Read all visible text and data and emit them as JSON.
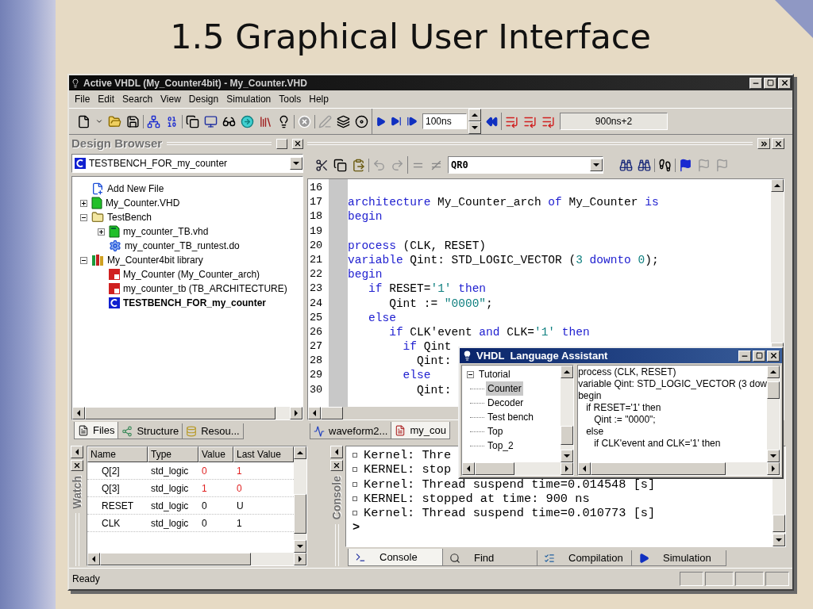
{
  "slide": {
    "title": "1.5 Graphical User Interface"
  },
  "window": {
    "title": "Active VHDL (My_Counter4bit) - My_Counter.VHD"
  },
  "menu": [
    "File",
    "Edit",
    "Search",
    "View",
    "Design",
    "Simulation",
    "Tools",
    "Help"
  ],
  "toolbar": {
    "time_step": "100ns",
    "sim_time": "900ns+2"
  },
  "design_browser": {
    "title": "Design Browser",
    "design": "TESTBENCH_FOR_my_counter",
    "tree": [
      {
        "label": "Add New File",
        "kind": "new_file"
      },
      {
        "label": "My_Counter.VHD",
        "kind": "source",
        "expanded": false
      },
      {
        "label": "TestBench",
        "kind": "folder",
        "expanded": true,
        "children": [
          {
            "label": "my_counter_TB.vhd",
            "kind": "testbench",
            "expanded": false
          },
          {
            "label": "my_counter_TB_runtest.do",
            "kind": "macro"
          }
        ]
      },
      {
        "label": "My_Counter4bit library",
        "kind": "library",
        "expanded": true,
        "children": [
          {
            "label": "My_Counter (My_Counter_arch)",
            "kind": "entity"
          },
          {
            "label": "my_counter_tb (TB_ARCHITECTURE)",
            "kind": "entity"
          },
          {
            "label": "TESTBENCH_FOR_my_counter",
            "kind": "config",
            "top_level": true
          }
        ]
      }
    ],
    "tabs": [
      {
        "label": "Files",
        "kind": "files",
        "selected": true
      },
      {
        "label": "Structure",
        "kind": "structure",
        "selected": false
      },
      {
        "label": "Resou...",
        "kind": "resources",
        "selected": false
      }
    ]
  },
  "editor": {
    "search": "QR0",
    "lines": [
      {
        "number": "16"
      },
      {
        "number": "17",
        "tokens": [
          {
            "text": "architecture",
            "kind": "keyword"
          },
          {
            "text": " My_Counter_arch ",
            "kind": "plain"
          },
          {
            "text": "of",
            "kind": "keyword"
          },
          {
            "text": " My_Counter ",
            "kind": "plain"
          },
          {
            "text": "is",
            "kind": "keyword"
          }
        ]
      },
      {
        "number": "18",
        "tokens": [
          {
            "text": "begin",
            "kind": "keyword"
          }
        ]
      },
      {
        "number": "19"
      },
      {
        "number": "20",
        "tokens": [
          {
            "text": "process",
            "kind": "keyword"
          },
          {
            "text": " (CLK, RESET)",
            "kind": "plain"
          }
        ]
      },
      {
        "number": "21",
        "tokens": [
          {
            "text": "variable",
            "kind": "keyword"
          },
          {
            "text": " Qint: STD_LOGIC_VECTOR (",
            "kind": "plain"
          },
          {
            "text": "3",
            "kind": "literal"
          },
          {
            "text": " downto",
            "kind": "keyword"
          },
          {
            "text": " 0",
            "kind": "literal"
          },
          {
            "text": ");",
            "kind": "plain"
          }
        ]
      },
      {
        "number": "22",
        "tokens": [
          {
            "text": "begin",
            "kind": "keyword"
          }
        ]
      },
      {
        "number": "23",
        "tokens": [
          {
            "text": "   if",
            "kind": "keyword"
          },
          {
            "text": " RESET=",
            "kind": "plain"
          },
          {
            "text": "'1'",
            "kind": "literal"
          },
          {
            "text": " then",
            "kind": "keyword"
          }
        ]
      },
      {
        "number": "24",
        "tokens": [
          {
            "text": "      Qint := ",
            "kind": "plain"
          },
          {
            "text": "\"0000\"",
            "kind": "literal"
          },
          {
            "text": ";",
            "kind": "plain"
          }
        ]
      },
      {
        "number": "25",
        "tokens": [
          {
            "text": "   else",
            "kind": "keyword"
          }
        ]
      },
      {
        "number": "26",
        "tokens": [
          {
            "text": "      if",
            "kind": "keyword"
          },
          {
            "text": " CLK'event ",
            "kind": "plain"
          },
          {
            "text": "and",
            "kind": "keyword"
          },
          {
            "text": " CLK=",
            "kind": "plain"
          },
          {
            "text": "'1'",
            "kind": "literal"
          },
          {
            "text": " then",
            "kind": "keyword"
          }
        ]
      },
      {
        "number": "27",
        "tokens": [
          {
            "text": "        if",
            "kind": "keyword"
          },
          {
            "text": " Qint",
            "kind": "plain"
          }
        ]
      },
      {
        "number": "28",
        "tokens": [
          {
            "text": "          Qint:",
            "kind": "plain"
          }
        ]
      },
      {
        "number": "29",
        "tokens": [
          {
            "text": "        else",
            "kind": "keyword"
          }
        ]
      },
      {
        "number": "30",
        "tokens": [
          {
            "text": "          Qint:",
            "kind": "plain"
          }
        ]
      }
    ],
    "tabs": [
      {
        "label": "waveform2...",
        "kind": "waveform",
        "selected": false
      },
      {
        "label": "my_cou",
        "kind": "source",
        "selected": true
      }
    ]
  },
  "watch": {
    "title": "Watch",
    "columns": [
      "Name",
      "Type",
      "Value",
      "Last Value"
    ],
    "rows": [
      {
        "name": "Q[2]",
        "type": "std_logic",
        "value": "0",
        "last_value": "1",
        "changed": true
      },
      {
        "name": "Q[3]",
        "type": "std_logic",
        "value": "1",
        "last_value": "0",
        "changed": true
      },
      {
        "name": "RESET",
        "type": "std_logic",
        "value": "0",
        "last_value": "U",
        "changed": false
      },
      {
        "name": "CLK",
        "type": "std_logic",
        "value": "0",
        "last_value": "1",
        "changed": false
      }
    ]
  },
  "console": {
    "title": "Console",
    "lines": [
      "Kernel: Thre",
      "KERNEL: stop",
      "Kernel: Thread suspend time=0.014548 [s]",
      "KERNEL: stopped at time: 900 ns",
      "Kernel: Thread suspend time=0.010773 [s]"
    ],
    "prompt": ">",
    "tabs": [
      {
        "label": "Console",
        "kind": "console",
        "selected": true
      },
      {
        "label": "Find",
        "kind": "find",
        "selected": false
      },
      {
        "label": "Compilation",
        "kind": "compile",
        "selected": false
      },
      {
        "label": "Simulation",
        "kind": "simulation",
        "selected": false
      }
    ]
  },
  "status_bar": {
    "text": "Ready"
  },
  "assistant": {
    "title": "VHDL  Language Assistant",
    "tree": [
      {
        "label": "Tutorial",
        "expanded": true,
        "selected": false,
        "children": [
          {
            "label": "Counter",
            "selected": true
          },
          {
            "label": "Decoder",
            "selected": false
          },
          {
            "label": "Test bench",
            "selected": false
          },
          {
            "label": "Top",
            "selected": false
          },
          {
            "label": "Top_2",
            "selected": false
          }
        ]
      }
    ],
    "code": [
      "process (CLK, RESET)",
      "variable Qint: STD_LOGIC_VECTOR (3 dow",
      "begin",
      "   if RESET='1' then",
      "      Qint := \"0000\";",
      "   else",
      "      if CLK'event and CLK='1' then"
    ]
  }
}
